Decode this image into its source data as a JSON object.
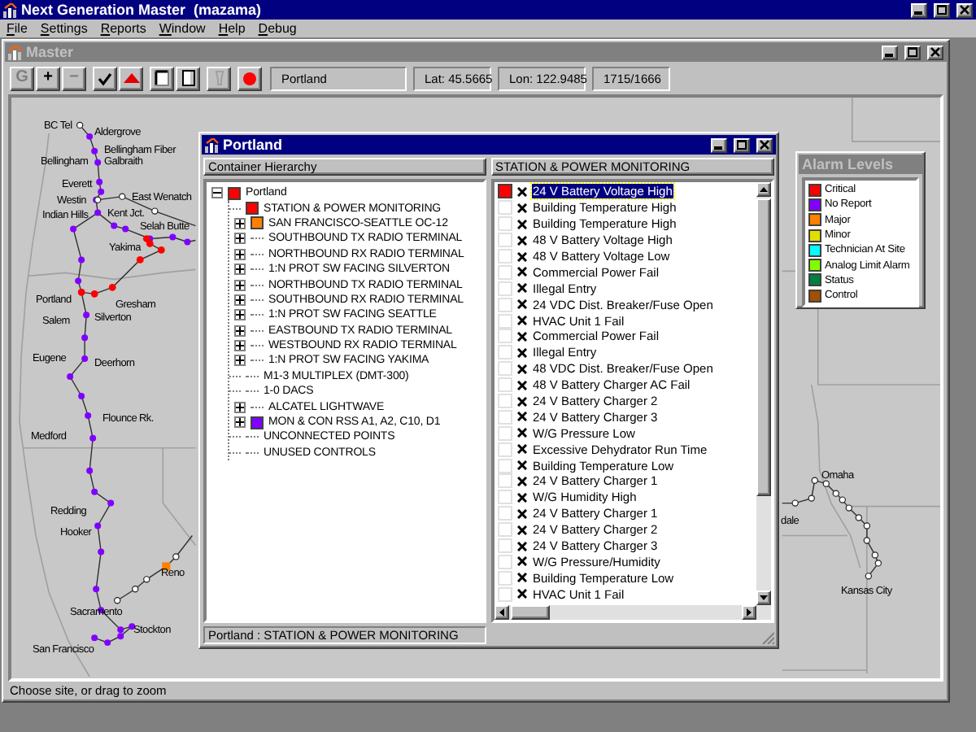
{
  "app": {
    "title": "Next Generation Master  (mazama)"
  },
  "menu": [
    "File",
    "Settings",
    "Reports",
    "Window",
    "Help",
    "Debug"
  ],
  "master": {
    "title": "Master",
    "toolbar": [
      {
        "kind": "text",
        "label": "G",
        "disabled": true
      },
      {
        "kind": "text",
        "label": "+",
        "disabled": false
      },
      {
        "kind": "text",
        "label": "−",
        "disabled": true
      },
      {
        "kind": "check",
        "disabled": false
      },
      {
        "kind": "triangle",
        "disabled": false
      },
      {
        "kind": "frame",
        "disabled": false
      },
      {
        "kind": "page",
        "disabled": false
      },
      {
        "kind": "bulb",
        "disabled": true
      },
      {
        "kind": "record",
        "disabled": false
      }
    ],
    "location": "Portland",
    "lat": "Lat: 45.5665",
    "lon": "Lon: 122.9485",
    "counts": "1715/1666",
    "sites": [
      {
        "name": "BC Tel"
      },
      {
        "name": "Aldergrove"
      },
      {
        "name": "Bellingham Fiber"
      },
      {
        "name": "Galbraith"
      },
      {
        "name": "Bellingham"
      },
      {
        "name": "Everett"
      },
      {
        "name": "Westin"
      },
      {
        "name": "East Wenatch"
      },
      {
        "name": "Indian Hills"
      },
      {
        "name": "Kent Jct."
      },
      {
        "name": "Selah Butte"
      },
      {
        "name": "Yakima"
      },
      {
        "name": "Portland"
      },
      {
        "name": "Gresham"
      },
      {
        "name": "Salem"
      },
      {
        "name": "Silverton"
      },
      {
        "name": "Eugene"
      },
      {
        "name": "Deerhorn"
      },
      {
        "name": "Flounce Rk."
      },
      {
        "name": "Medford"
      },
      {
        "name": "Redding"
      },
      {
        "name": "Hooker"
      },
      {
        "name": "Reno"
      },
      {
        "name": "Sacramento"
      },
      {
        "name": "Stockton"
      },
      {
        "name": "San Francisco"
      },
      {
        "name": "Omaha"
      },
      {
        "name": "dale"
      },
      {
        "name": "Kansas City"
      }
    ],
    "status": "Choose site, or drag to zoom"
  },
  "portland": {
    "title": "Portland",
    "tree_header": "Container Hierarchy",
    "tree": {
      "label": "Portland",
      "color": "#ff0000",
      "expanded": true,
      "children": [
        {
          "label": "STATION & POWER MONITORING",
          "color": "#ff0000",
          "expandable": false
        },
        {
          "label": "SAN FRANCISCO-SEATTLE OC-12",
          "color": "#ff8000",
          "expandable": true
        },
        {
          "label": "SOUTHBOUND TX RADIO TERMINAL",
          "expandable": true
        },
        {
          "label": "NORTHBOUND RX RADIO TERMINAL",
          "expandable": true
        },
        {
          "label": "1:N PROT SW FACING SILVERTON",
          "expandable": true
        },
        {
          "label": "NORTHBOUND TX  RADIO TERMINAL",
          "expandable": true
        },
        {
          "label": "SOUTHBOUND RX RADIO TERMINAL",
          "expandable": true
        },
        {
          "label": "1:N PROT SW FACING SEATTLE",
          "expandable": true
        },
        {
          "label": "EASTBOUND TX RADIO TERMINAL",
          "expandable": true
        },
        {
          "label": "WESTBOUND RX RADIO TERMINAL",
          "expandable": true
        },
        {
          "label": "1:N PROT SW FACING YAKIMA",
          "expandable": true
        },
        {
          "label": "M1-3 MULTIPLEX (DMT-300)",
          "expandable": false
        },
        {
          "label": "1-0 DACS",
          "expandable": false
        },
        {
          "label": "ALCATEL LIGHTWAVE",
          "expandable": true
        },
        {
          "label": "MON & CON RSS A1, A2, C10, D1",
          "color": "#8000ff",
          "expandable": true
        },
        {
          "label": "UNCONNECTED POINTS",
          "expandable": false
        },
        {
          "label": "UNUSED CONTROLS",
          "expandable": false
        }
      ]
    },
    "points_header": "STATION & POWER MONITORING",
    "points": [
      {
        "label": "24 V Battery Voltage High",
        "color": "#ff0000",
        "selected": true
      },
      {
        "label": "Building Temperature High",
        "color": "#ffffff",
        "selected": false
      },
      {
        "label": "Building Temperature High",
        "color": "#ffffff",
        "selected": false
      },
      {
        "label": "48 V Battery Voltage High",
        "color": "#ffffff",
        "selected": false
      },
      {
        "label": "48 V Battery Voltage Low",
        "color": "#ffffff",
        "selected": false
      },
      {
        "label": "Commercial Power Fail",
        "color": "#ffffff",
        "selected": false
      },
      {
        "label": "Illegal Entry",
        "color": "#ffffff",
        "selected": false
      },
      {
        "label": "24 VDC Dist. Breaker/Fuse Open",
        "color": "#ffffff",
        "selected": false
      },
      {
        "label": "HVAC Unit 1 Fail",
        "color": "#ffffff",
        "selected": false
      },
      {
        "label": "Commercial Power Fail",
        "color": "#ffffff",
        "selected": false
      },
      {
        "label": "Illegal Entry",
        "color": "#ffffff",
        "selected": false
      },
      {
        "label": "48 VDC Dist. Breaker/Fuse Open",
        "color": "#ffffff",
        "selected": false
      },
      {
        "label": "48 V Battery Charger AC Fail",
        "color": "#ffffff",
        "selected": false
      },
      {
        "label": "24 V Battery Charger 2",
        "color": "#ffffff",
        "selected": false
      },
      {
        "label": "24 V Battery Charger 3",
        "color": "#ffffff",
        "selected": false
      },
      {
        "label": "W/G Pressure Low",
        "color": "#ffffff",
        "selected": false
      },
      {
        "label": "Excessive Dehydrator Run Time",
        "color": "#ffffff",
        "selected": false
      },
      {
        "label": "Building Temperature Low",
        "color": "#ffffff",
        "selected": false
      },
      {
        "label": "24 V Battery Charger 1",
        "color": "#ffffff",
        "selected": false
      },
      {
        "label": "W/G Humidity High",
        "color": "#ffffff",
        "selected": false
      },
      {
        "label": "24 V Battery Charger 1",
        "color": "#ffffff",
        "selected": false
      },
      {
        "label": "24 V Battery Charger 2",
        "color": "#ffffff",
        "selected": false
      },
      {
        "label": "24 V Battery Charger 3",
        "color": "#ffffff",
        "selected": false
      },
      {
        "label": "W/G Pressure/Humidity",
        "color": "#ffffff",
        "selected": false
      },
      {
        "label": "Building Temperature Low",
        "color": "#ffffff",
        "selected": false
      },
      {
        "label": "HVAC Unit 1 Fail",
        "color": "#ffffff",
        "selected": false
      }
    ],
    "status": "Portland : STATION & POWER MONITORING"
  },
  "alarm_levels": {
    "title": "Alarm Levels",
    "levels": [
      {
        "label": "Critical",
        "color": "#ff0000"
      },
      {
        "label": "No Report",
        "color": "#8000ff"
      },
      {
        "label": "Major",
        "color": "#ff8000"
      },
      {
        "label": "Minor",
        "color": "#e0e000"
      },
      {
        "label": "Technician At Site",
        "color": "#00ffff"
      },
      {
        "label": "Analog Limit Alarm",
        "color": "#80ff00"
      },
      {
        "label": "Status",
        "color": "#008040"
      },
      {
        "label": "Control",
        "color": "#a05000"
      }
    ]
  }
}
